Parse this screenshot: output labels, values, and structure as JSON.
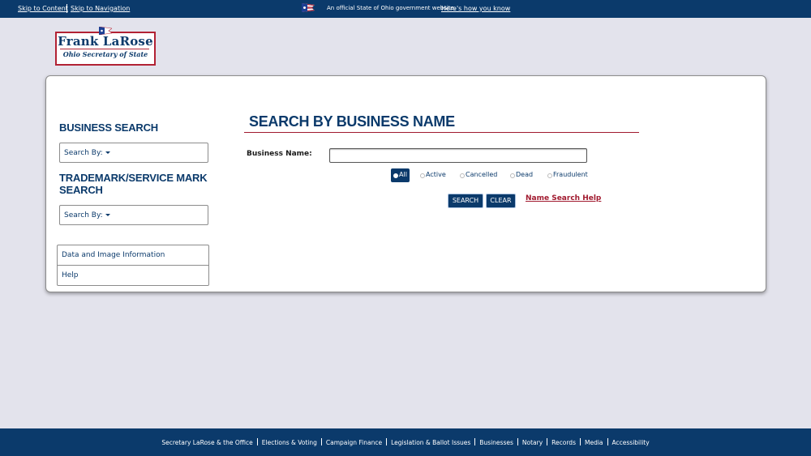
{
  "topbar": {
    "skip_content": "Skip to Content",
    "skip_navigation": "Skip to Navigation",
    "official_text": "An official State of Ohio government website.",
    "how_you_know": "Here's how you know"
  },
  "logo": {
    "name": "Frank LaRose",
    "subtitle": "Ohio Secretary of State"
  },
  "sidebar": {
    "business_heading": "BUSINESS SEARCH",
    "business_select": "Search By:",
    "trademark_heading_line1": "TRADEMARK/SERVICE MARK",
    "trademark_heading_line2": "SEARCH",
    "trademark_select": "Search By:",
    "links": [
      "Data and Image Information",
      "Help"
    ]
  },
  "main": {
    "title": "SEARCH BY BUSINESS NAME",
    "business_name_label": "Business Name:",
    "business_name_value": "",
    "status_options": [
      "All",
      "Active",
      "Cancelled",
      "Dead",
      "Fraudulent"
    ],
    "selected_status": "All",
    "search_button": "SEARCH",
    "clear_button": "CLEAR",
    "help_link": "Name Search Help"
  },
  "footer": {
    "links": [
      "Secretary LaRose & the Office",
      "Elections & Voting",
      "Campaign Finance",
      "Legislation & Ballot Issues",
      "Businesses",
      "Notary",
      "Records",
      "Media",
      "Accessibility"
    ]
  },
  "colors": {
    "brand_navy": "#0b3a6b",
    "accent_red": "#a11a2f",
    "page_bg": "#e3e3ec"
  }
}
